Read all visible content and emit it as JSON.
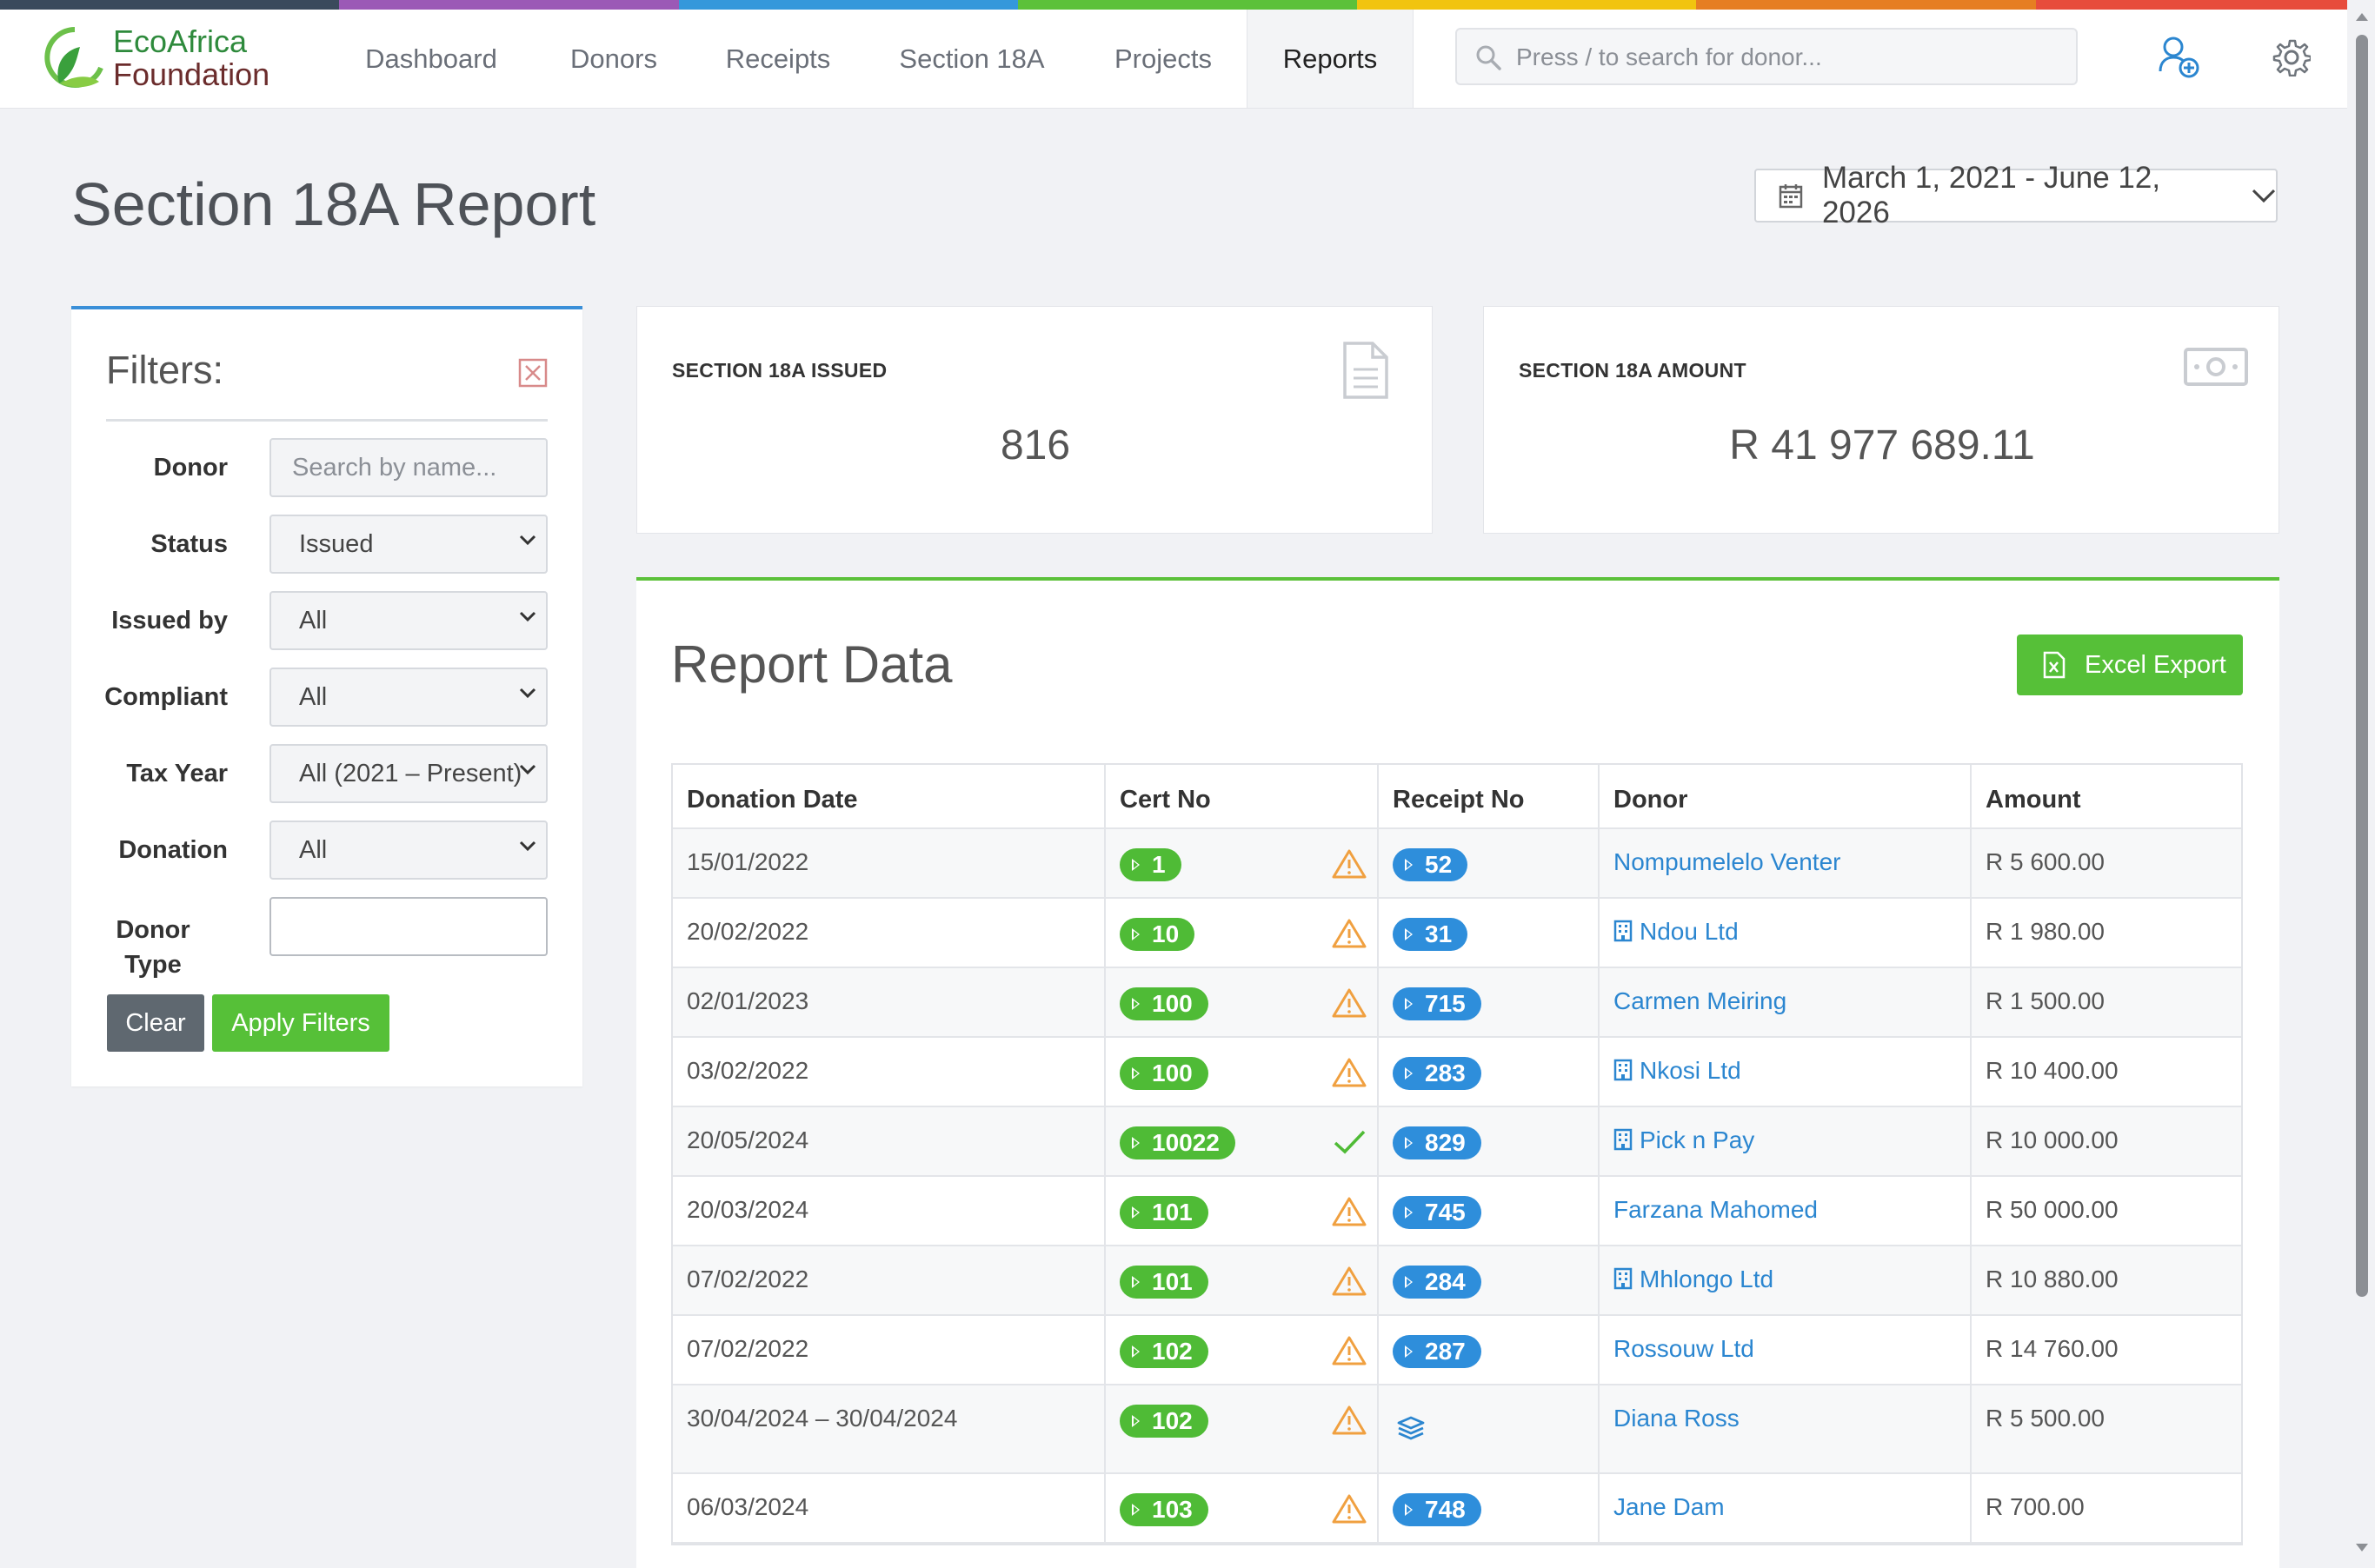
{
  "app": {
    "logo_line1": "EcoAfrica",
    "logo_line2": "Foundation",
    "stripe_colors": [
      "#3a4a5c",
      "#9b59b6",
      "#3498db",
      "#5cc13a",
      "#f1c40f",
      "#e67e22",
      "#e74c3c"
    ]
  },
  "nav": {
    "items": [
      {
        "label": "Dashboard"
      },
      {
        "label": "Donors"
      },
      {
        "label": "Receipts"
      },
      {
        "label": "Section 18A"
      },
      {
        "label": "Projects"
      },
      {
        "label": "Reports",
        "active": true
      }
    ],
    "search_placeholder": "Press / to search for donor...",
    "icons": [
      "add-user-icon",
      "gear-icon",
      "search-icon"
    ]
  },
  "page": {
    "title": "Section 18A Report",
    "date_range": "March 1, 2021 - June 12, 2026"
  },
  "filters": {
    "title": "Filters:",
    "fields": {
      "donor": {
        "label": "Donor",
        "placeholder": "Search by name..."
      },
      "status": {
        "label": "Status",
        "value": "Issued"
      },
      "issued_by": {
        "label": "Issued by",
        "value": "All"
      },
      "compliant": {
        "label": "Compliant",
        "value": "All"
      },
      "tax_year": {
        "label": "Tax Year",
        "value": "All (2021 – Present)"
      },
      "donation": {
        "label": "Donation",
        "value": "All"
      },
      "donor_type": {
        "label_line1": "Donor",
        "label_line2": "Type",
        "value": ""
      }
    },
    "clear_label": "Clear",
    "apply_label": "Apply Filters"
  },
  "stats": {
    "issued": {
      "label": "SECTION 18A ISSUED",
      "value": "816"
    },
    "amount": {
      "label": "SECTION 18A AMOUNT",
      "value": "R 41 977 689.11"
    }
  },
  "report": {
    "title": "Report Data",
    "export_label": "Excel Export",
    "columns": [
      "Donation Date",
      "Cert No",
      "Receipt No",
      "Donor",
      "Amount"
    ],
    "rows": [
      {
        "date": "15/01/2022",
        "cert": "1",
        "status": "warning",
        "receipt": "52",
        "donor": "Nompumelelo Venter",
        "company": false,
        "amount": "R 5 600.00"
      },
      {
        "date": "20/02/2022",
        "cert": "10",
        "status": "warning",
        "receipt": "31",
        "donor": "Ndou Ltd",
        "company": true,
        "amount": "R 1 980.00"
      },
      {
        "date": "02/01/2023",
        "cert": "100",
        "status": "warning",
        "receipt": "715",
        "donor": "Carmen Meiring",
        "company": false,
        "amount": "R 1 500.00"
      },
      {
        "date": "03/02/2022",
        "cert": "100",
        "status": "warning",
        "receipt": "283",
        "donor": "Nkosi Ltd",
        "company": true,
        "amount": "R 10 400.00"
      },
      {
        "date": "20/05/2024",
        "cert": "10022",
        "status": "ok",
        "receipt": "829",
        "donor": "Pick n Pay",
        "company": true,
        "amount": "R 10 000.00"
      },
      {
        "date": "20/03/2024",
        "cert": "101",
        "status": "warning",
        "receipt": "745",
        "donor": "Farzana Mahomed",
        "company": false,
        "amount": "R 50 000.00"
      },
      {
        "date": "07/02/2022",
        "cert": "101",
        "status": "warning",
        "receipt": "284",
        "donor": "Mhlongo Ltd",
        "company": true,
        "amount": "R 10 880.00"
      },
      {
        "date": "07/02/2022",
        "cert": "102",
        "status": "warning",
        "receipt": "287",
        "donor": "Rossouw Ltd",
        "company": false,
        "amount": "R 14 760.00"
      },
      {
        "date": "30/04/2024 – 30/04/2024",
        "cert": "102",
        "status": "warning",
        "receipt": "",
        "multi": true,
        "donor": "Diana Ross",
        "company": false,
        "amount": "R 5 500.00"
      },
      {
        "date": "06/03/2024",
        "cert": "103",
        "status": "warning",
        "receipt": "748",
        "donor": "Jane Dam",
        "company": false,
        "amount": "R 700.00"
      }
    ]
  }
}
